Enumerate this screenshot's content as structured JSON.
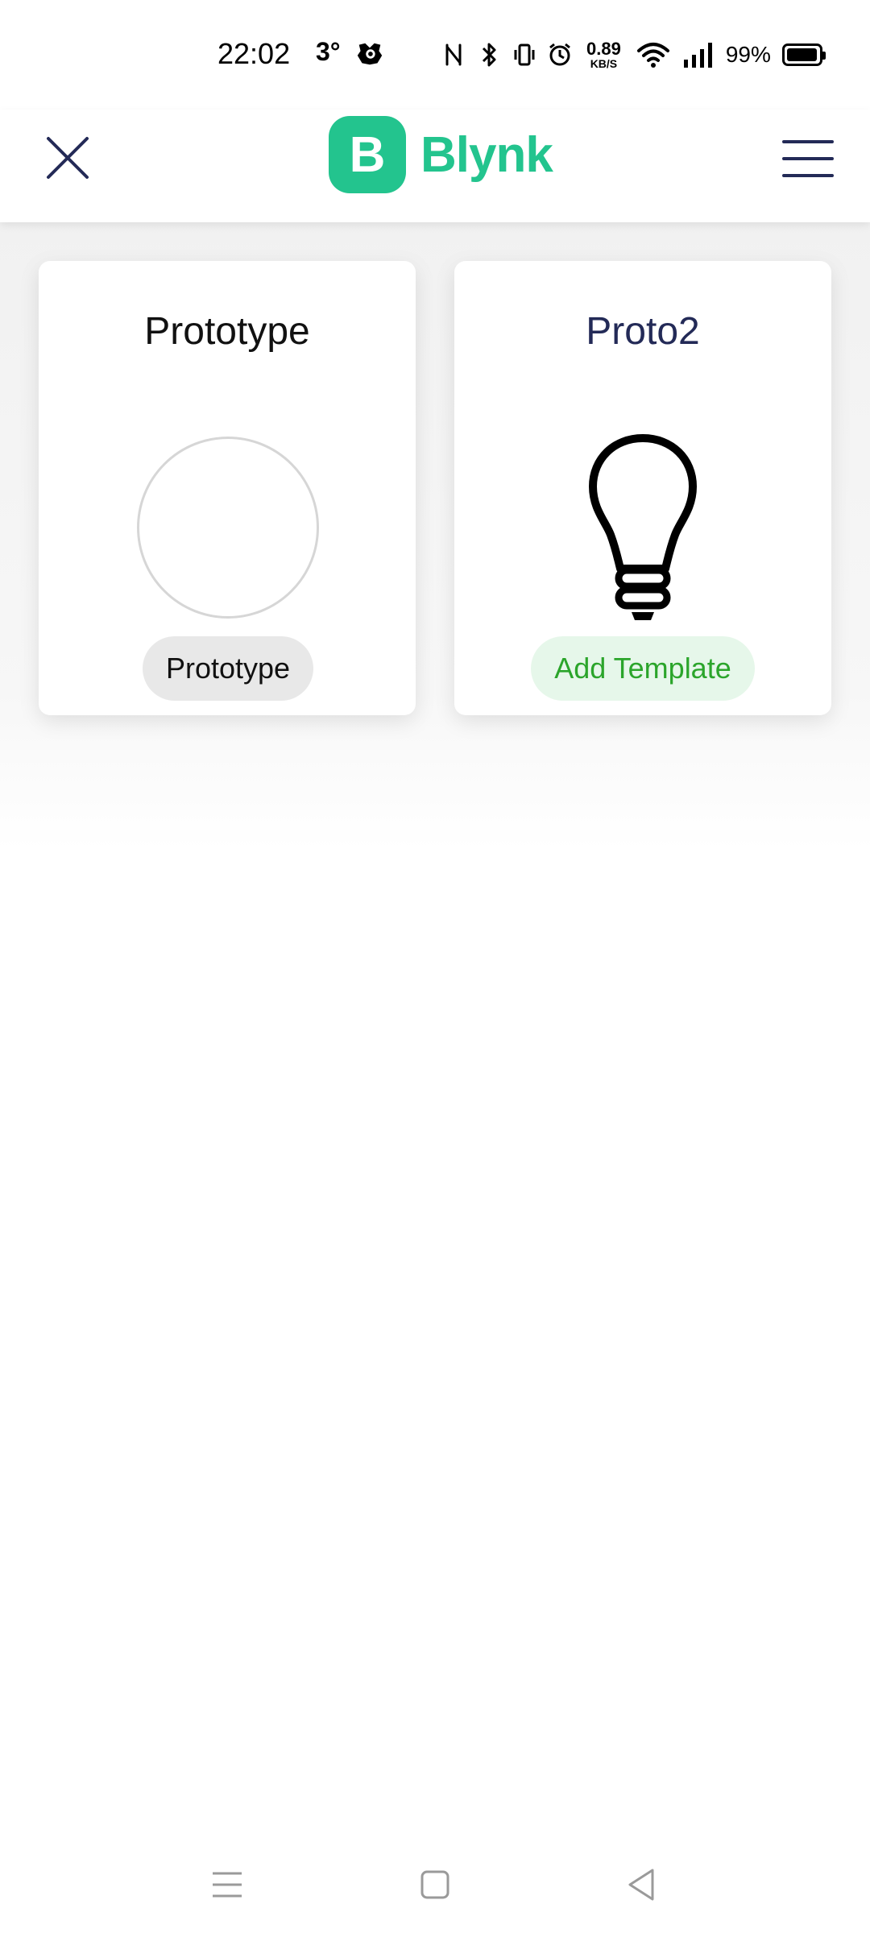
{
  "status_bar": {
    "time": "22:02",
    "temperature": "3°",
    "speed_value": "0.89",
    "speed_unit": "KB/S",
    "battery": "99%",
    "battery_level": 0.99
  },
  "header": {
    "logo_letter": "B",
    "logo_text": "Blynk",
    "brand_color": "#23c48e"
  },
  "cards": [
    {
      "title": "Prototype",
      "image": "empty-circle",
      "pill_label": "Prototype"
    },
    {
      "title": "Proto2",
      "image": "lightbulb-icon",
      "pill_label": "Add Template",
      "pill_color": "#2ba52b"
    }
  ]
}
